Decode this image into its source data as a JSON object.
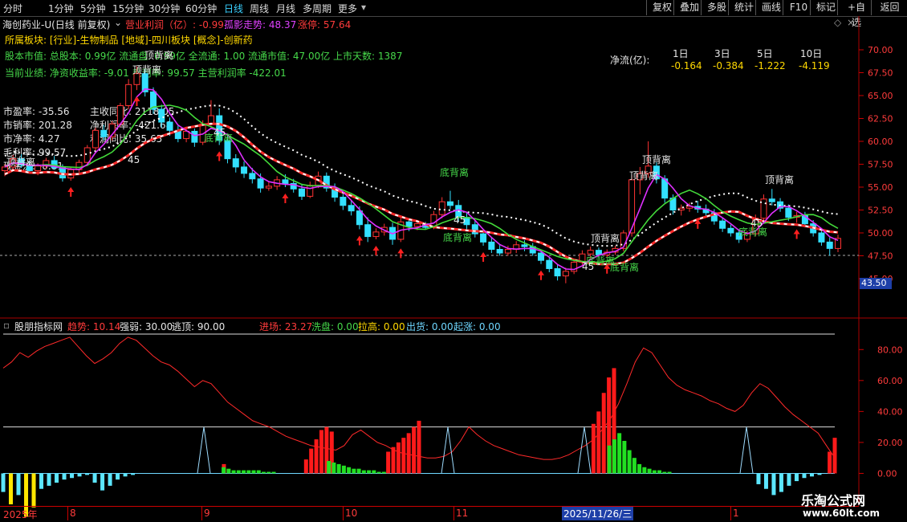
{
  "toolbar": {
    "tabs": [
      "分时",
      "1分钟",
      "5分钟",
      "15分钟",
      "30分钟",
      "60分钟",
      "日线",
      "周线",
      "月线",
      "多周期",
      "更多"
    ],
    "active_tab": "日线",
    "buttons": [
      "复权",
      "叠加",
      "多股",
      "统计",
      "画线",
      "F10",
      "标记",
      "+自选",
      "返回"
    ]
  },
  "header": {
    "stock": "海创药业-U(日线 前复权)",
    "profit_label": "营业利润（亿）: -0.99",
    "lonely_label": "孤影走势: 48.37",
    "limit_label": "涨停: 57.64",
    "sector": "所属板块: [行业]-生物制品 [地域]-四川板块 [概念]-创新药",
    "capital": "股本市值: 总股本: 0.99亿 流通盘: 0.99亿 全流通: 1.00 流通市值: 47.00亿 上市天数: 1387",
    "performance": "当前业绩: 净资收益率: -9.01 毛利率: 99.57 主营利润率 -422.01"
  },
  "fundamentals": [
    {
      "label": "市盈率: -35.56"
    },
    {
      "label": "主收同比: 2118.05"
    },
    {
      "label": "市销率: 201.28"
    },
    {
      "label": "净利润率: -421.68"
    },
    {
      "label": "市净率: 4.27"
    },
    {
      "label": "利润同比: 35.65"
    },
    {
      "label": "毛利率: 99.57"
    },
    {
      "label": "现金流: -0.81"
    }
  ],
  "netflow": {
    "label": "净流(亿):",
    "periods": [
      "1日",
      "3日",
      "5日",
      "10日"
    ],
    "values": [
      "-0.164",
      "-0.384",
      "-1.222",
      "-4.119"
    ]
  },
  "indicator": {
    "name": "股朋指标网",
    "trend": "趋势: 10.14",
    "strength": "强弱: 30.00",
    "escape": "逃顶: 90.00",
    "entry": "进场: 23.27",
    "wash": "洗盘: 0.00",
    "pull": "拉高: 0.00",
    "ship": "出货: 0.00",
    "rise": "起涨: 0.00"
  },
  "price_badge": "43.50",
  "dates": [
    "2025年",
    "8",
    "9",
    "10",
    "11",
    "2025/11/26/三",
    "1"
  ],
  "watermark": {
    "line1": "乐淘公式网",
    "line2": "www.60lt.com"
  },
  "annotations": {
    "top": "顶背离",
    "bottom": "底背离",
    "fast": "45"
  },
  "chart_data": [
    {
      "type": "candlestick",
      "ylim": [
        45,
        70
      ],
      "y_ticks": [
        "70.00",
        "67.50",
        "65.00",
        "62.50",
        "60.00",
        "57.50",
        "55.00",
        "52.50",
        "50.00",
        "47.50",
        "45.00"
      ],
      "ohlc": [
        [
          56.8,
          57.5,
          56.2,
          57.2
        ],
        [
          57.2,
          58.5,
          56.9,
          58.1
        ],
        [
          58.1,
          58.6,
          57.1,
          57.4
        ],
        [
          57.4,
          57.9,
          56.5,
          56.8
        ],
        [
          56.8,
          57.6,
          56.3,
          57.3
        ],
        [
          57.3,
          58.2,
          57.0,
          57.9
        ],
        [
          57.9,
          58.4,
          56.9,
          57.1
        ],
        [
          57.1,
          57.5,
          55.6,
          56.0
        ],
        [
          56.0,
          57.2,
          55.7,
          56.9
        ],
        [
          56.9,
          58.0,
          56.6,
          57.7
        ],
        [
          57.7,
          59.6,
          57.4,
          59.3
        ],
        [
          59.3,
          61.5,
          59.0,
          61.2
        ],
        [
          61.2,
          61.8,
          60.1,
          60.5
        ],
        [
          60.5,
          62.2,
          60.1,
          61.9
        ],
        [
          61.9,
          64.2,
          61.6,
          63.9
        ],
        [
          63.9,
          66.8,
          63.5,
          66.2
        ],
        [
          66.2,
          68.2,
          65.6,
          67.4
        ],
        [
          67.4,
          67.9,
          64.9,
          65.4
        ],
        [
          65.4,
          65.9,
          63.0,
          63.5
        ],
        [
          63.5,
          64.0,
          61.5,
          62.1
        ],
        [
          62.1,
          62.6,
          60.6,
          61.2
        ],
        [
          61.2,
          61.7,
          59.9,
          60.3
        ],
        [
          60.3,
          61.6,
          59.9,
          61.1
        ],
        [
          61.1,
          61.4,
          59.4,
          59.9
        ],
        [
          59.9,
          62.3,
          59.6,
          61.9
        ],
        [
          61.9,
          64.5,
          61.7,
          62.8
        ],
        [
          62.8,
          63.6,
          59.6,
          60.1
        ],
        [
          60.1,
          60.7,
          57.6,
          58.1
        ],
        [
          58.1,
          58.6,
          56.6,
          57.2
        ],
        [
          57.2,
          57.8,
          56.0,
          56.5
        ],
        [
          56.5,
          57.1,
          55.4,
          55.9
        ],
        [
          55.9,
          56.5,
          54.4,
          54.9
        ],
        [
          54.9,
          55.6,
          54.6,
          55.1
        ],
        [
          55.1,
          56.2,
          54.7,
          55.8
        ],
        [
          55.8,
          56.4,
          55.0,
          55.4
        ],
        [
          55.4,
          55.9,
          54.4,
          54.8
        ],
        [
          54.8,
          55.3,
          53.6,
          54.0
        ],
        [
          54.0,
          55.6,
          53.8,
          55.2
        ],
        [
          55.2,
          56.7,
          54.9,
          56.2
        ],
        [
          56.2,
          56.6,
          54.5,
          54.9
        ],
        [
          54.9,
          55.4,
          53.4,
          53.9
        ],
        [
          53.9,
          54.4,
          52.5,
          53.0
        ],
        [
          53.0,
          53.5,
          51.9,
          52.4
        ],
        [
          52.4,
          52.9,
          50.4,
          50.9
        ],
        [
          50.9,
          51.7,
          49.0,
          49.6
        ],
        [
          49.6,
          50.5,
          49.3,
          50.1
        ],
        [
          50.1,
          51.0,
          49.7,
          50.6
        ],
        [
          50.6,
          51.1,
          48.7,
          49.3
        ],
        [
          49.3,
          51.7,
          49.0,
          51.2
        ],
        [
          51.2,
          51.6,
          50.2,
          50.7
        ],
        [
          50.7,
          51.3,
          50.3,
          51.0
        ],
        [
          51.0,
          51.2,
          50.4,
          50.6
        ],
        [
          50.6,
          52.4,
          50.4,
          52.0
        ],
        [
          52.0,
          53.9,
          51.6,
          53.4
        ],
        [
          53.4,
          54.6,
          52.6,
          53.0
        ],
        [
          53.0,
          53.6,
          51.2,
          51.7
        ],
        [
          51.7,
          52.2,
          50.4,
          50.9
        ],
        [
          50.9,
          51.4,
          49.5,
          49.9
        ],
        [
          49.9,
          50.3,
          48.6,
          49.0
        ],
        [
          49.0,
          49.5,
          47.8,
          48.2
        ],
        [
          48.2,
          48.7,
          47.5,
          47.8
        ],
        [
          47.8,
          48.6,
          47.5,
          48.2
        ],
        [
          48.2,
          49.1,
          47.8,
          48.7
        ],
        [
          48.7,
          49.2,
          48.0,
          48.5
        ],
        [
          48.5,
          48.9,
          47.5,
          47.8
        ],
        [
          47.8,
          48.2,
          46.6,
          47.0
        ],
        [
          47.0,
          47.4,
          45.7,
          46.1
        ],
        [
          46.1,
          46.5,
          44.8,
          45.3
        ],
        [
          45.3,
          46.2,
          44.5,
          45.8
        ],
        [
          45.8,
          47.1,
          45.5,
          46.8
        ],
        [
          46.8,
          48.1,
          46.5,
          47.7
        ],
        [
          47.7,
          48.5,
          47.2,
          48.1
        ],
        [
          48.1,
          48.4,
          47.3,
          47.6
        ],
        [
          47.6,
          48.2,
          47.3,
          47.9
        ],
        [
          47.9,
          48.6,
          47.6,
          48.3
        ],
        [
          48.3,
          50.3,
          48.0,
          50.0
        ],
        [
          50.0,
          56.3,
          49.6,
          55.8
        ],
        [
          55.8,
          57.2,
          54.2,
          56.5
        ],
        [
          56.5,
          60.0,
          56.0,
          57.3
        ],
        [
          57.3,
          57.7,
          55.4,
          55.9
        ],
        [
          55.9,
          56.3,
          53.3,
          53.8
        ],
        [
          53.8,
          54.2,
          52.0,
          52.5
        ],
        [
          52.5,
          53.1,
          51.9,
          52.7
        ],
        [
          52.7,
          53.3,
          52.3,
          52.9
        ],
        [
          52.9,
          53.5,
          52.2,
          52.6
        ],
        [
          52.6,
          53.1,
          51.8,
          52.2
        ],
        [
          52.2,
          52.6,
          50.9,
          51.3
        ],
        [
          51.3,
          51.7,
          50.1,
          50.5
        ],
        [
          50.5,
          50.9,
          49.6,
          50.0
        ],
        [
          50.0,
          50.4,
          48.9,
          49.3
        ],
        [
          49.3,
          50.2,
          49.0,
          49.9
        ],
        [
          49.9,
          52.0,
          49.6,
          51.6
        ],
        [
          51.6,
          54.2,
          51.3,
          53.7
        ],
        [
          53.7,
          54.8,
          53.0,
          53.4
        ],
        [
          53.4,
          53.8,
          52.3,
          52.7
        ],
        [
          52.7,
          53.1,
          51.3,
          51.7
        ],
        [
          51.7,
          52.3,
          51.1,
          51.9
        ],
        [
          51.9,
          52.3,
          50.6,
          51.0
        ],
        [
          51.0,
          51.4,
          49.6,
          50.0
        ],
        [
          50.0,
          50.4,
          48.6,
          49.0
        ],
        [
          49.0,
          49.5,
          47.5,
          48.3
        ],
        [
          48.3,
          49.8,
          47.9,
          49.4
        ]
      ]
    },
    {
      "type": "bar",
      "ylim": [
        -20,
        90
      ],
      "y_ticks": [
        "80.00",
        "60.00",
        "40.00",
        "20.00",
        "0.00"
      ],
      "reference_lines": [
        90,
        30
      ],
      "series": [
        {
          "name": "趋势",
          "values": [
            68,
            72,
            78,
            75,
            79,
            82,
            84,
            86,
            88,
            82,
            76,
            71,
            74,
            78,
            84,
            88,
            86,
            81,
            76,
            72,
            70,
            66,
            61,
            56,
            60,
            58,
            52,
            46,
            42,
            38,
            34,
            32,
            30,
            27,
            24,
            22,
            20,
            18,
            17,
            16,
            15,
            18,
            25,
            28,
            24,
            20,
            18,
            15,
            13,
            12,
            11,
            10,
            10,
            11,
            14,
            21,
            30,
            25,
            21,
            18,
            16,
            14,
            12,
            11,
            10,
            9,
            9,
            10,
            12,
            15,
            18,
            22,
            28,
            35,
            45,
            58,
            72,
            81,
            78,
            70,
            62,
            57,
            54,
            52,
            50,
            47,
            45,
            42,
            40,
            44,
            52,
            58,
            55,
            49,
            43,
            38,
            34,
            30,
            26,
            18,
            10
          ]
        },
        {
          "name": "进场",
          "values": [
            0,
            0,
            0,
            0,
            0,
            0,
            0,
            0,
            0,
            0,
            0,
            0,
            0,
            0,
            0,
            0,
            0,
            0,
            0,
            0,
            0,
            0,
            0,
            0,
            0,
            0,
            0,
            0,
            0,
            0,
            0,
            0,
            0,
            0,
            0,
            0,
            0,
            0,
            0,
            0,
            0,
            0,
            0,
            6,
            0,
            0,
            0,
            0,
            0,
            0,
            0,
            0,
            0,
            0,
            0,
            0,
            0,
            0,
            0,
            9,
            16,
            22,
            28,
            30,
            27,
            0,
            0,
            0,
            0,
            0,
            0,
            0,
            0,
            0,
            0,
            14,
            17,
            20,
            23,
            26,
            30,
            34,
            0,
            0,
            0,
            0,
            0,
            0,
            0,
            0,
            0,
            0,
            0,
            0,
            0,
            0,
            0,
            0,
            0,
            0,
            0,
            0,
            0,
            0,
            0,
            0,
            0,
            0,
            0,
            0,
            0,
            0,
            0,
            0,
            0,
            32,
            40,
            52,
            62,
            68,
            0,
            0,
            0,
            0,
            0,
            0,
            0,
            0,
            0,
            0,
            0,
            0,
            0,
            0,
            0,
            0,
            0,
            0,
            0,
            0,
            0,
            0,
            0,
            0,
            0,
            0,
            0,
            0,
            0,
            0,
            0,
            0,
            0,
            0,
            0,
            0,
            0,
            0,
            0,
            0,
            0,
            14,
            23
          ]
        },
        {
          "name": "洗盘",
          "values": [
            0,
            0,
            0,
            0,
            0,
            0,
            0,
            0,
            0,
            0,
            0,
            0,
            0,
            0,
            0,
            0,
            0,
            0,
            0,
            0,
            0,
            0,
            0,
            0,
            0,
            0,
            0,
            0,
            0,
            0,
            0,
            0,
            0,
            0,
            0,
            0,
            0,
            0,
            0,
            0,
            0,
            0,
            0,
            0,
            4,
            3,
            2,
            2,
            2,
            2,
            2,
            2,
            1,
            1,
            1,
            0,
            0,
            0,
            0,
            0,
            0,
            0,
            0,
            0,
            0,
            8,
            7,
            6,
            5,
            4,
            3,
            3,
            2,
            2,
            2,
            1,
            1,
            0,
            0,
            0,
            0,
            0,
            0,
            0,
            0,
            0,
            0,
            0,
            0,
            0,
            0,
            0,
            0,
            0,
            0,
            0,
            0,
            0,
            0,
            0,
            0,
            0,
            0,
            0,
            0,
            0,
            0,
            0,
            0,
            0,
            0,
            0,
            0,
            0,
            0,
            0,
            0,
            0,
            0,
            0,
            0,
            18,
            22,
            26,
            21,
            15,
            10,
            6,
            4,
            3,
            2,
            2,
            1,
            1,
            0,
            0,
            0,
            0,
            0,
            0,
            0,
            0,
            0,
            0,
            0,
            0,
            0,
            0,
            0,
            0,
            0,
            0,
            0,
            0,
            0,
            0,
            0,
            0,
            0,
            0,
            0,
            0,
            0,
            0,
            0,
            0,
            0
          ]
        },
        {
          "name": "出货",
          "values": [
            -12,
            -20,
            -14,
            -28,
            -22,
            -10,
            -8,
            -6,
            -4,
            -3,
            -2,
            -1,
            -6,
            -11,
            -8,
            -4,
            -2,
            -1,
            0,
            0,
            0,
            0,
            0,
            0,
            0,
            0,
            0,
            0,
            0,
            0,
            0,
            0,
            0,
            0,
            0,
            0,
            0,
            0,
            0,
            0,
            0,
            0,
            0,
            0,
            0,
            0,
            0,
            0,
            0,
            0,
            0,
            0,
            0,
            0,
            0,
            0,
            0,
            0,
            0,
            0,
            0,
            0,
            0,
            0,
            0,
            0,
            0,
            0,
            0,
            0,
            0,
            0,
            0,
            0,
            0,
            0,
            0,
            0,
            0,
            0,
            0,
            0,
            0,
            0,
            0,
            0,
            0,
            0,
            0,
            0,
            0,
            0,
            0,
            0,
            0,
            0,
            0,
            0,
            0,
            -7,
            -10,
            -14,
            -12,
            -8,
            -5,
            -3,
            -2,
            -1,
            0,
            0
          ]
        }
      ]
    }
  ]
}
